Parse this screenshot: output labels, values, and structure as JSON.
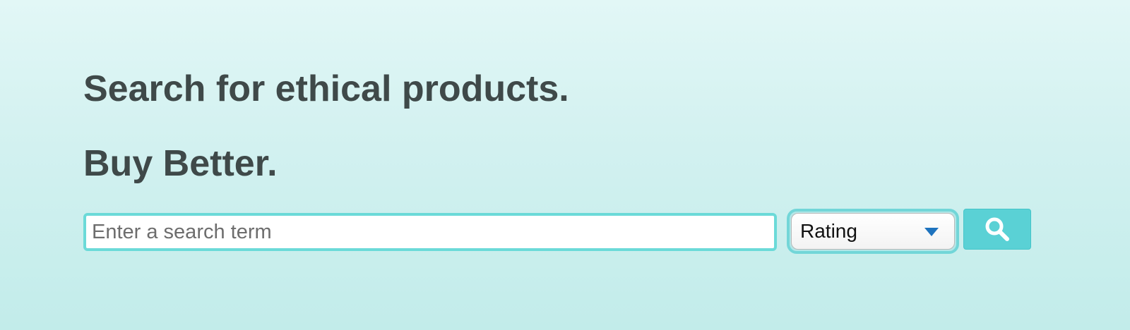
{
  "hero": {
    "headline_1": "Search for ethical products.",
    "headline_2": "Buy Better."
  },
  "search": {
    "placeholder": "Enter a search term",
    "value": ""
  },
  "sort_select": {
    "selected": "Rating"
  },
  "search_button": {
    "icon": "search-icon",
    "label": "Search"
  },
  "colors": {
    "accent": "#5ad1d5",
    "input_border": "#6bdad8",
    "headline": "#3f4949",
    "select_arrow": "#1e73be"
  }
}
